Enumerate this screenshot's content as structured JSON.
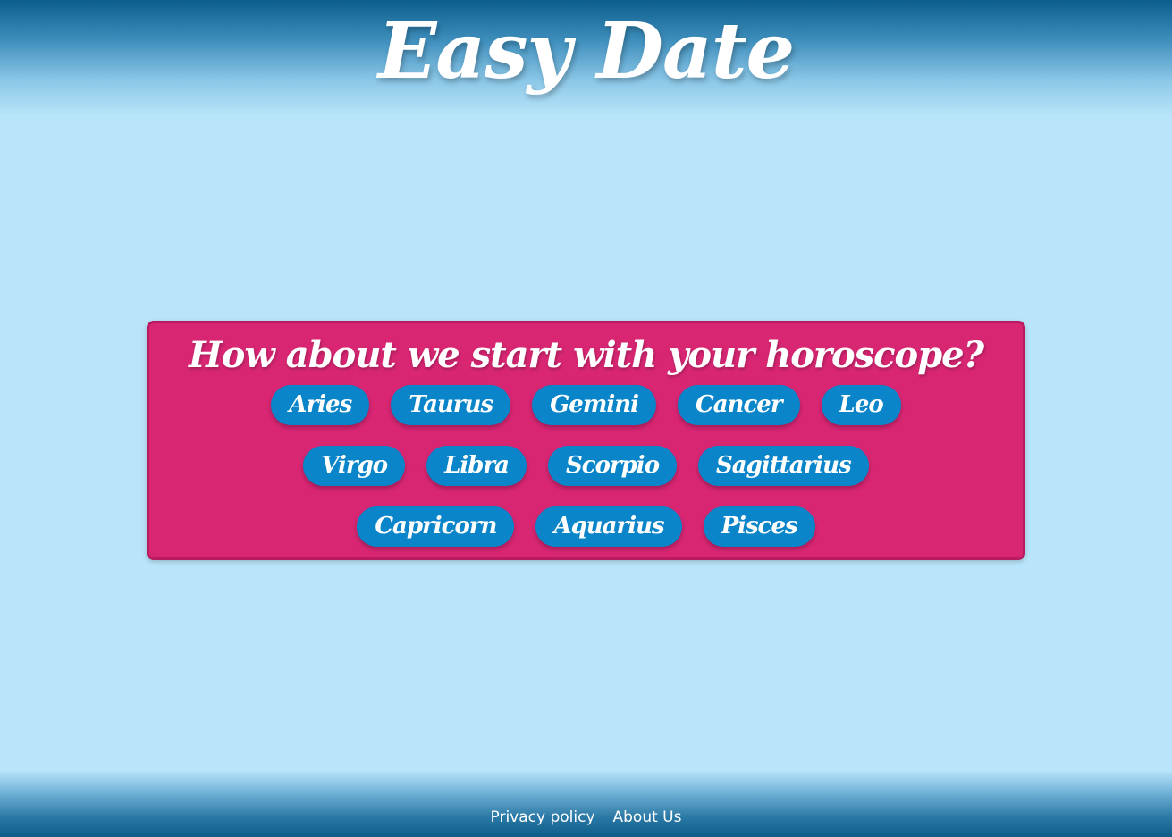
{
  "header": {
    "title": "Easy Date"
  },
  "panel": {
    "title": "How about we start with your horoscope?",
    "rows": [
      [
        "Aries",
        "Taurus",
        "Gemini",
        "Cancer",
        "Leo"
      ],
      [
        "Virgo",
        "Libra",
        "Scorpio",
        "Sagittarius"
      ],
      [
        "Capricorn",
        "Aquarius",
        "Pisces"
      ]
    ]
  },
  "footer": {
    "privacy_label": "Privacy policy",
    "about_label": "About Us"
  },
  "colors": {
    "background": "#b9e5fa",
    "panel": "#d82673",
    "button": "#0a85c9",
    "header_dark": "#0b5d8c"
  }
}
